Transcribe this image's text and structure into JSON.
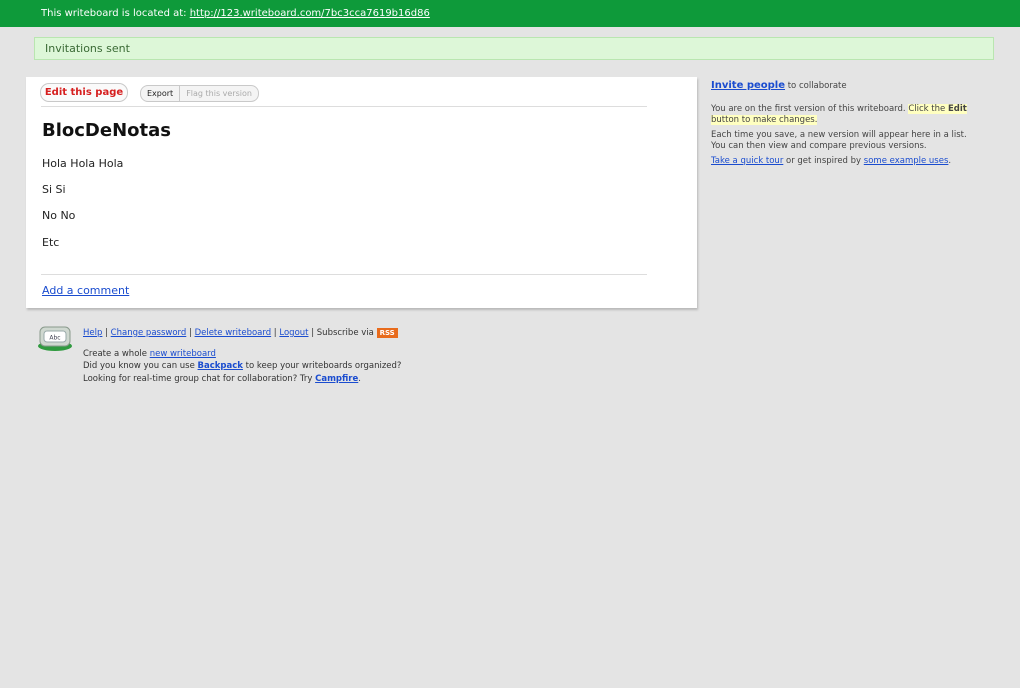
{
  "topbar": {
    "label": "This writeboard is located at:",
    "url": "http://123.writeboard.com/7bc3cca7619b16d86"
  },
  "flash": {
    "message": "Invitations sent"
  },
  "toolbar": {
    "edit_label": "Edit this page",
    "export_label": "Export",
    "flag_label": "Flag this version"
  },
  "document": {
    "title": "BlocDeNotas",
    "lines": [
      "Hola Hola Hola",
      "Si Si",
      "No No",
      "Etc"
    ]
  },
  "add_comment_label": "Add a comment",
  "sidebar": {
    "invite_link": "Invite people",
    "invite_suffix": "to collaborate",
    "first_version_text": "You are on the first version of this writeboard.",
    "click_the": "Click the",
    "edit_word": "Edit",
    "button_to_make_changes": "button to make changes.",
    "versions_text": "Each time you save, a new version will appear here in a list. You can then view and compare previous versions.",
    "quick_tour_link": "Take a quick tour",
    "inspired_text": "or get inspired by",
    "example_uses_link": "some example uses",
    "period": "."
  },
  "footer": {
    "icon_text": "Abc",
    "links": [
      "Help",
      "Change password",
      "Delete writeboard",
      "Logout"
    ],
    "subscribe_text": "Subscribe via",
    "rss_badge": "RSS",
    "create_text": "Create a whole",
    "new_writeboard_link": "new writeboard",
    "backpack_pre": "Did you know you can use",
    "backpack_link": "Backpack",
    "backpack_post": "to keep your writeboards organized?",
    "campfire_pre": "Looking for real-time group chat for collaboration? Try",
    "campfire_link": "Campfire",
    "campfire_post": "."
  },
  "colors": {
    "topbar_bg": "#0e9a3a",
    "flash_bg": "#ddf7d8",
    "edit_button_text": "#d61f1f",
    "link": "#1a4ccf",
    "page_bg": "#e4e4e4"
  }
}
